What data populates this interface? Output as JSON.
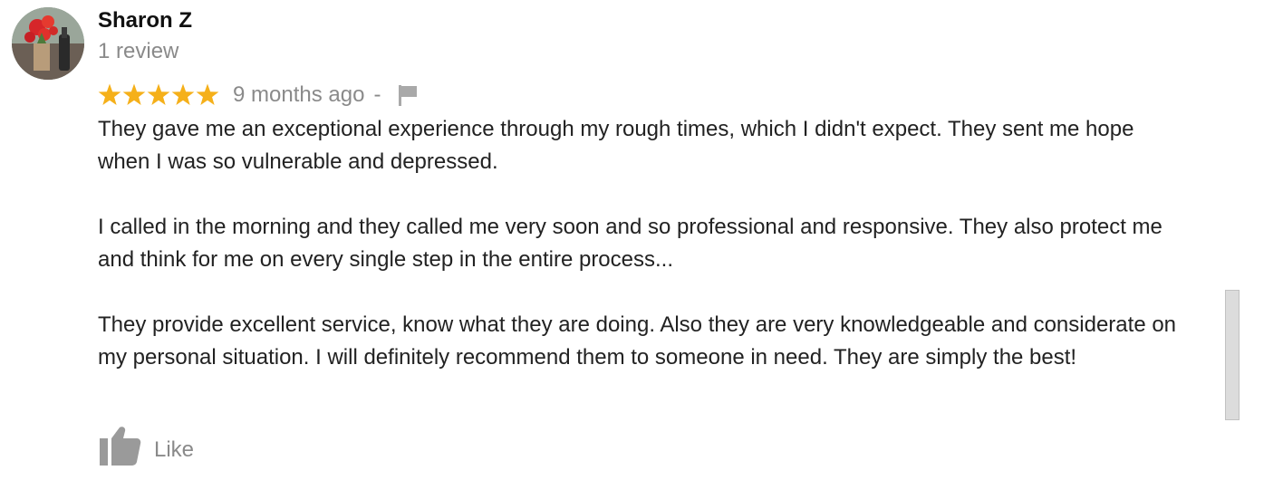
{
  "review": {
    "author_name": "Sharon Z",
    "review_count": "1 review",
    "rating": 5,
    "rating_max": 5,
    "time_ago": "9 months ago",
    "separator": "-",
    "paragraphs": [
      "They gave me an exceptional experience through my rough times, which I didn't expect. They sent me hope when I was so vulnerable and depressed.",
      "I called in the morning and they called me very soon and so professional and responsive. They also protect me and think for me on every single step in the entire process...",
      "They provide excellent service, know what they are doing. Also they are very knowledgeable and considerate on my personal situation. I will definitely recommend them to someone in need. They are simply the best!"
    ],
    "like_label": "Like"
  },
  "icons": {
    "avatar": "avatar-photo",
    "star": "star-icon",
    "flag": "flag-icon",
    "like": "thumbs-up-icon"
  },
  "colors": {
    "star": "#F5B01A",
    "muted_text": "#8A8A8A",
    "body_text": "#222222",
    "scrollbar": "#DCDCDC"
  }
}
